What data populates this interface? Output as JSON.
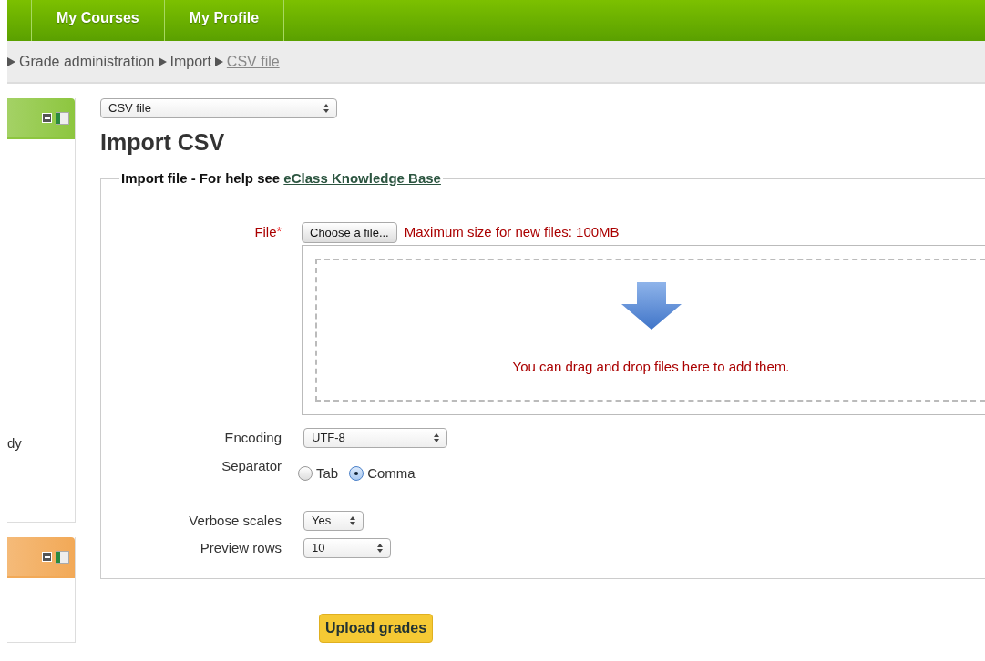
{
  "nav": {
    "tabs": [
      {
        "label": "My Courses"
      },
      {
        "label": "My Profile"
      }
    ]
  },
  "breadcrumb": [
    {
      "label": "Grade administration",
      "current": false
    },
    {
      "label": "Import",
      "current": false
    },
    {
      "label": "CSV file",
      "current": true
    }
  ],
  "sidebar": {
    "blocks": [
      {
        "color": "#8dc63f",
        "text": "dy"
      },
      {
        "color": "#f2a957"
      }
    ]
  },
  "import_select": {
    "value": "CSV file"
  },
  "heading": "Import CSV",
  "fieldset": {
    "legend": "Import file - For help see",
    "legend_link": "eClass Knowledge Base"
  },
  "fields": [
    {
      "kind": "file",
      "label": "File",
      "required_mark": "*",
      "button": "Choose a file...",
      "note": "Maximum size for new files: 100MB",
      "drop_text": "You can drag and drop files here to add them."
    },
    {
      "kind": "select",
      "label": "Encoding",
      "value": "UTF-8"
    },
    {
      "kind": "radio",
      "label": "Separator",
      "options": [
        {
          "label": "Tab",
          "selected": false
        },
        {
          "label": "Comma",
          "selected": true
        }
      ]
    },
    {
      "kind": "select",
      "label": "Verbose scales",
      "value": "Yes"
    },
    {
      "kind": "select",
      "label": "Preview rows",
      "value": "10"
    }
  ],
  "submit": "Upload grades"
}
